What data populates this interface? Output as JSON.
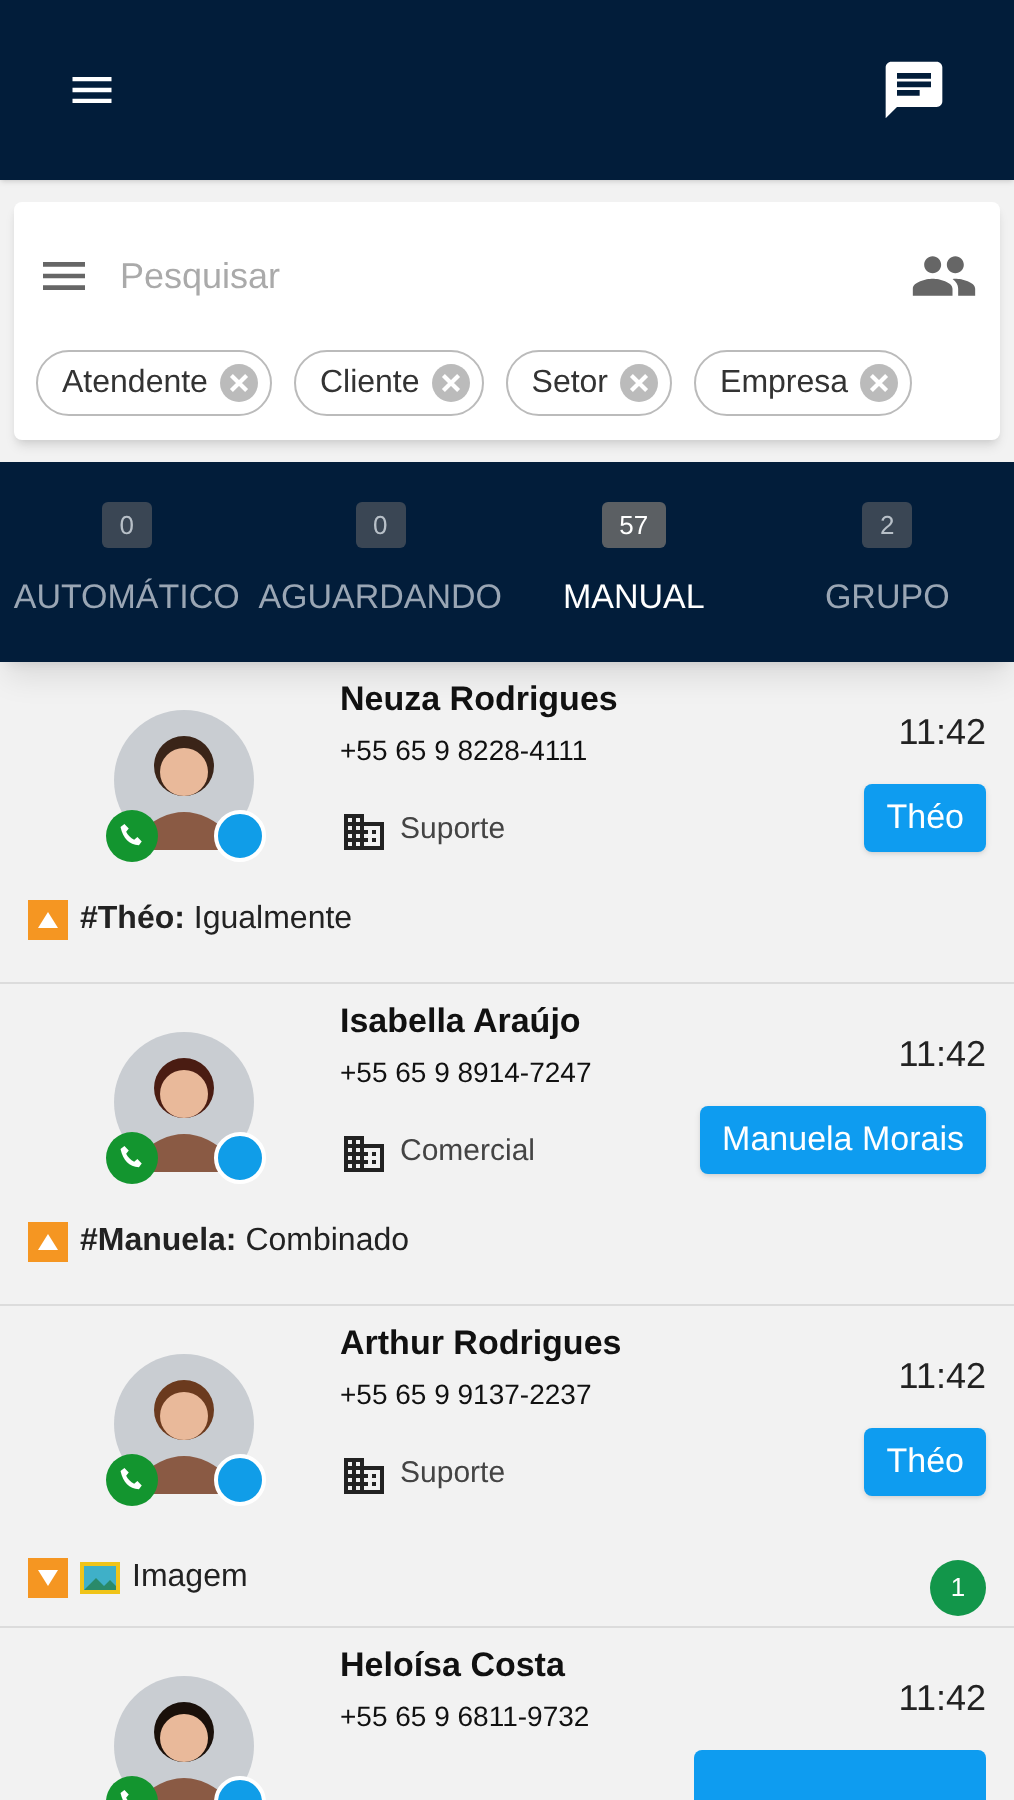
{
  "search": {
    "placeholder": "Pesquisar"
  },
  "filters": [
    {
      "label": "Atendente"
    },
    {
      "label": "Cliente"
    },
    {
      "label": "Setor"
    },
    {
      "label": "Empresa"
    }
  ],
  "tabs": [
    {
      "label": "AUTOMÁTICO",
      "count": "0",
      "selected": false
    },
    {
      "label": "AGUARDANDO",
      "count": "0",
      "selected": false
    },
    {
      "label": "MANUAL",
      "count": "57",
      "selected": true
    },
    {
      "label": "GRUPO",
      "count": "2",
      "selected": false
    }
  ],
  "chats": [
    {
      "name": "Neuza Rodrigues",
      "phone": "+55 65 9 8228-4111",
      "time": "11:42",
      "sector": "Suporte",
      "agent": "Théo",
      "outgoing": true,
      "kind": "text",
      "preview": "**#Théo:** Igualmente"
    },
    {
      "name": "Isabella Araújo",
      "phone": "+55 65 9 8914-7247",
      "time": "11:42",
      "sector": "Comercial",
      "agent": "Manuela Morais",
      "outgoing": true,
      "kind": "text",
      "preview": "**#Manuela:** Combinado"
    },
    {
      "name": "Arthur Rodrigues",
      "phone": "+55 65 9 9137-2237",
      "time": "11:42",
      "sector": "Suporte",
      "agent": "Théo",
      "outgoing": false,
      "kind": "image",
      "preview": "Imagem",
      "unread": "1"
    },
    {
      "name": "Heloísa Costa",
      "phone": "+55 65 9 6811-9732",
      "time": "11:42",
      "agent_tag_cut": true
    }
  ]
}
